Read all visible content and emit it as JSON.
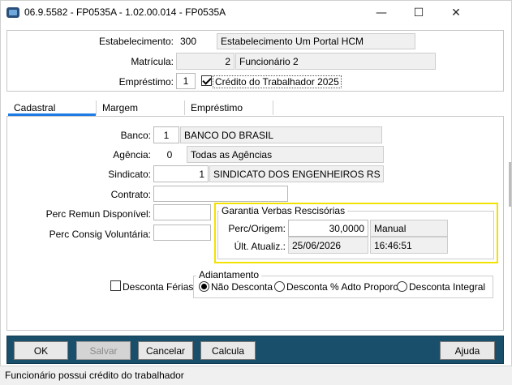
{
  "window": {
    "title": "06.9.5582 - FP0535A - 1.02.00.014 - FP0535A",
    "minimize": "—",
    "maximize": "☐",
    "close": "✕"
  },
  "header": {
    "estabelecimento": {
      "label": "Estabelecimento:",
      "code": "300",
      "name": "Estabelecimento Um Portal HCM"
    },
    "matricula": {
      "label": "Matrícula:",
      "code": "2",
      "name": "Funcionário 2"
    },
    "emprestimo": {
      "label": "Empréstimo:",
      "code": "1",
      "checkbox_label": "Crédito do Trabalhador 2025",
      "checked": true
    }
  },
  "tabs": [
    {
      "label": "Cadastral",
      "active": true
    },
    {
      "label": "Margem",
      "active": false
    },
    {
      "label": "Empréstimo",
      "active": false
    }
  ],
  "cadastral": {
    "banco": {
      "label": "Banco:",
      "code": "1",
      "name": "BANCO DO BRASIL"
    },
    "agencia": {
      "label": "Agência:",
      "code": "0",
      "name": "Todas as Agências"
    },
    "sindicato": {
      "label": "Sindicato:",
      "code": "1",
      "name": "SINDICATO DOS ENGENHEIROS RS"
    },
    "contrato": {
      "label": "Contrato:",
      "value": ""
    },
    "perc_remun": {
      "label": "Perc Remun Disponível:",
      "value": ""
    },
    "perc_consig": {
      "label": "Perc Consig Voluntária:",
      "value": ""
    },
    "garantia": {
      "title": "Garantia Verbas Rescisórias",
      "perc_label": "Perc/Origem:",
      "perc_value": "30,0000",
      "origem_value": "Manual",
      "ult_label": "Últ. Atualiz.:",
      "date": "25/06/2026",
      "time": "16:46:51"
    },
    "desconta_ferias": {
      "label": "Desconta Férias",
      "checked": false
    },
    "adiantamento": {
      "title": "Adiantamento",
      "options": [
        {
          "label": "Não Desconta",
          "selected": true
        },
        {
          "label": "Desconta % Adto Proporc",
          "selected": false
        },
        {
          "label": "Desconta Integral",
          "selected": false
        }
      ]
    }
  },
  "buttons": {
    "ok": "OK",
    "salvar": "Salvar",
    "cancelar": "Cancelar",
    "calcula": "Calcula",
    "ajuda": "Ajuda"
  },
  "status": "Funcionário possui crédito do trabalhador"
}
